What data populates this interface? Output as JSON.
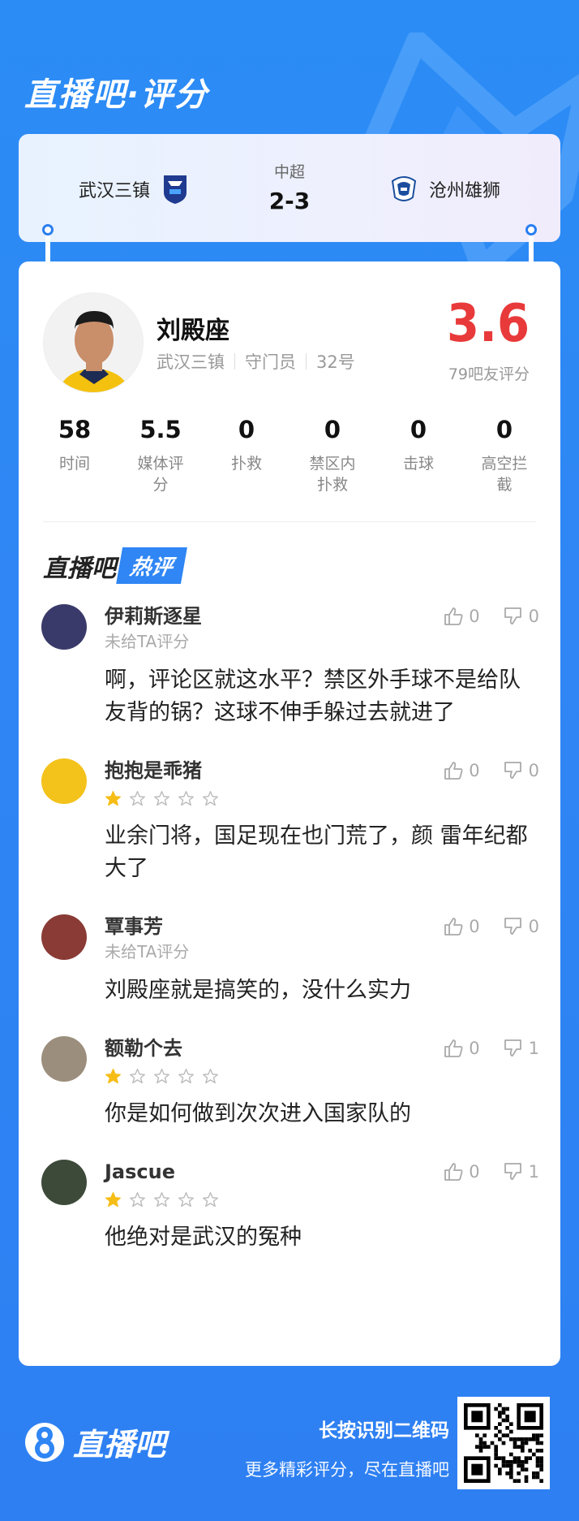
{
  "header": {
    "title": "直播吧·评分"
  },
  "match": {
    "league": "中超",
    "score": "2-3",
    "home_team": "武汉三镇",
    "away_team": "沧州雄狮"
  },
  "player": {
    "name": "刘殿座",
    "team": "武汉三镇",
    "position": "守门员",
    "number": "32号",
    "score": "3.6",
    "score_count": "79吧友评分"
  },
  "stats": [
    {
      "value": "58",
      "label": "时间"
    },
    {
      "value": "5.5",
      "label": "媒体评分"
    },
    {
      "value": "0",
      "label": "扑救"
    },
    {
      "value": "0",
      "label": "禁区内扑救"
    },
    {
      "value": "0",
      "label": "击球"
    },
    {
      "value": "0",
      "label": "高空拦截"
    }
  ],
  "hot": {
    "prefix": "直播吧",
    "tag": "热评"
  },
  "comments": [
    {
      "user": "伊莉斯逐星",
      "rating_text": "未给TA评分",
      "stars": 0,
      "text": "啊，评论区就这水平？禁区外手球不是给队友背的锅？这球不伸手躲过去就进了",
      "likes": "0",
      "dislikes": "0",
      "avatar_color": "#3a3a6a"
    },
    {
      "user": "抱抱是乖猪",
      "rating_text": "",
      "stars": 1,
      "text": "业余门将，国足现在也门荒了，颜 雷年纪都大了",
      "likes": "0",
      "dislikes": "0",
      "avatar_color": "#f3c21b"
    },
    {
      "user": "覃事芳",
      "rating_text": "未给TA评分",
      "stars": 0,
      "text": "刘殿座就是搞笑的，没什么实力",
      "likes": "0",
      "dislikes": "0",
      "avatar_color": "#8a3b36"
    },
    {
      "user": "额勒个去",
      "rating_text": "",
      "stars": 1,
      "text": "你是如何做到次次进入国家队的",
      "likes": "0",
      "dislikes": "1",
      "avatar_color": "#9b8e7c"
    },
    {
      "user": "Jascue",
      "rating_text": "",
      "stars": 1,
      "text": "他绝对是武汉的冤种",
      "likes": "0",
      "dislikes": "1",
      "avatar_color": "#3d4a3a"
    }
  ],
  "footer": {
    "logo_text": "直播吧",
    "qr_title": "长按识别二维码",
    "qr_subtitle": "更多精彩评分，尽在直播吧"
  },
  "colors": {
    "brand_blue": "#2f86f4",
    "score_red": "#e83a3a",
    "star_gold": "#f6bd16"
  }
}
